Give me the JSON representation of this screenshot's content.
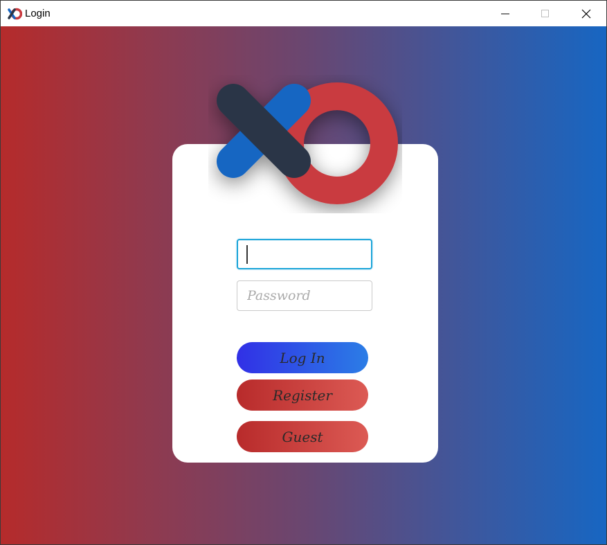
{
  "window": {
    "title": "Login",
    "icon": "xo-logo-icon",
    "controls": [
      "minimize",
      "maximize",
      "close"
    ]
  },
  "logo": {
    "icon": "xo-logo"
  },
  "form": {
    "username": {
      "value": "",
      "placeholder": ""
    },
    "password": {
      "value": "",
      "placeholder": "Password"
    }
  },
  "buttons": {
    "login": "Log In",
    "register": "Register",
    "guest": "Guest"
  },
  "colors": {
    "background_left": "#b52b2b",
    "background_right": "#1766c2",
    "x_blue": "#1766c2",
    "x_dark": "#2b3647",
    "o_red": "#c93a3f",
    "login_gradient_start": "#3130e6",
    "login_gradient_end": "#2b7de6",
    "red_gradient_start": "#b82b2b",
    "red_gradient_end": "#dc5a54"
  }
}
